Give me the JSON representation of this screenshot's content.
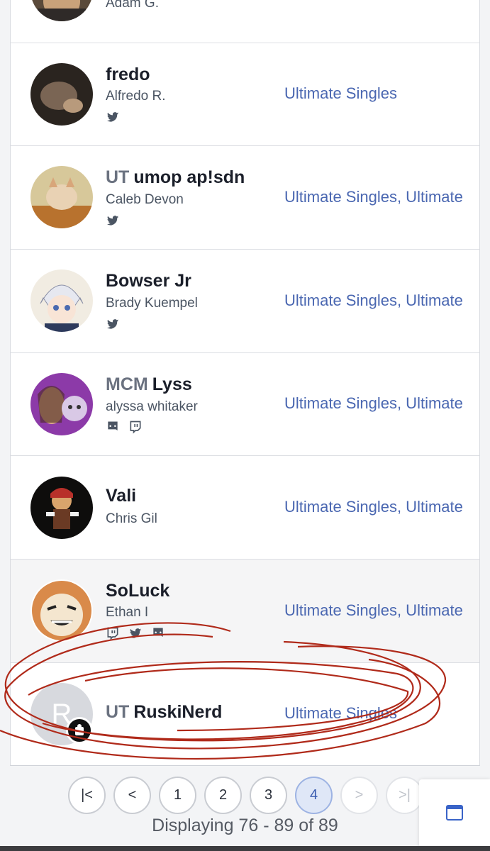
{
  "rows": [
    {
      "realname": "Adam G."
    },
    {
      "prefix": "",
      "tag": "fredo",
      "realname": "Alfredo R.",
      "events": "Ultimate Singles",
      "socials": [
        "twitter-icon"
      ]
    },
    {
      "prefix": "UT",
      "tag": "umop ap!sdn",
      "realname": "Caleb Devon",
      "events": "Ultimate Singles, Ultimate",
      "socials": [
        "twitter-icon"
      ]
    },
    {
      "prefix": "",
      "tag": "Bowser Jr",
      "realname": "Brady Kuempel",
      "events": "Ultimate Singles, Ultimate",
      "socials": [
        "twitter-icon"
      ]
    },
    {
      "prefix": "MCM",
      "tag": "Lyss",
      "realname": "alyssa whitaker",
      "events": "Ultimate Singles, Ultimate",
      "socials": [
        "discord-icon",
        "twitch-icon"
      ]
    },
    {
      "prefix": "",
      "tag": "Vali",
      "realname": "Chris Gil",
      "events": "Ultimate Singles, Ultimate",
      "socials": []
    },
    {
      "prefix": "",
      "tag": "SoLuck",
      "realname": "Ethan I",
      "events": "Ultimate Singles, Ultimate",
      "socials": [
        "twitch-icon",
        "twitter-icon",
        "discord-icon"
      ]
    },
    {
      "prefix": "UT",
      "tag": "RuskiNerd",
      "avatar_initial": "R",
      "events": "Ultimate Singles"
    }
  ],
  "pagination": {
    "first": "|<",
    "prev": "<",
    "pages": [
      "1",
      "2",
      "3",
      "4"
    ],
    "current": "4",
    "next": ">",
    "last": ">|",
    "display": "Displaying 76 - 89 of 89"
  },
  "colors": {
    "link": "#4a67b1",
    "annotation": "#b02a1a"
  }
}
